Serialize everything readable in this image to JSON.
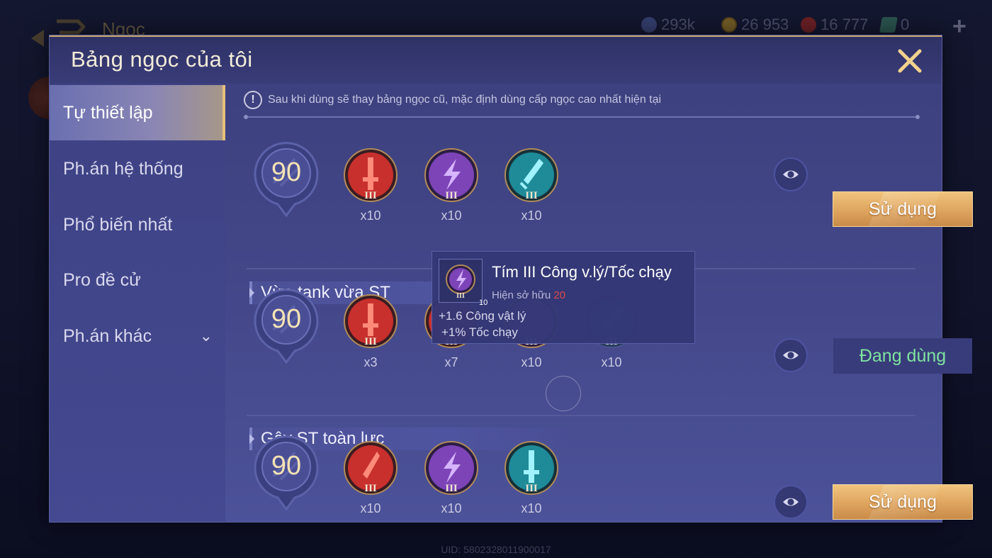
{
  "background": {
    "screen_title": "Ngọc",
    "currencies": [
      {
        "icon": "silver-coin-icon",
        "value": "293k"
      },
      {
        "icon": "gold-coin-icon",
        "value": "26 953"
      },
      {
        "icon": "ruby-icon",
        "value": "16 777"
      },
      {
        "icon": "voucher-icon",
        "value": "0"
      }
    ],
    "uid": "UID: 5802328011900017"
  },
  "modal": {
    "title": "Bảng ngọc của tôi",
    "notice": "Sau khi dùng sẽ thay bảng ngọc cũ, mặc định dùng cấp ngọc cao nhất hiện tại"
  },
  "sidebar": {
    "items": [
      {
        "label": "Tự thiết lập",
        "active": true
      },
      {
        "label": "Ph.án hệ thống",
        "active": false
      },
      {
        "label": "Phổ biến nhất",
        "active": false
      },
      {
        "label": "Pro đề cử",
        "active": false
      },
      {
        "label": "Ph.án khác",
        "active": false
      }
    ]
  },
  "sets": [
    {
      "name": "",
      "level": "90",
      "gems": [
        {
          "color": "red",
          "tier": "III",
          "count": "x10"
        },
        {
          "color": "purple",
          "tier": "III",
          "count": "x10"
        },
        {
          "color": "teal",
          "tier": "III",
          "count": "x10"
        }
      ],
      "action": "Sử dụng"
    },
    {
      "name": "Vừa tank vừa ST",
      "level": "90",
      "gems": [
        {
          "color": "red",
          "tier": "III",
          "count": "x3"
        },
        {
          "color": "red",
          "tier": "III",
          "count": "x7"
        },
        {
          "color": "purple",
          "tier": "III",
          "count": "x10"
        },
        {
          "color": "teal",
          "tier": "III",
          "count": "x10"
        }
      ],
      "action": "Đang dùng"
    },
    {
      "name": "Gây ST toàn lực",
      "level": "90",
      "gems": [
        {
          "color": "red",
          "tier": "III",
          "count": "x10"
        },
        {
          "color": "purple",
          "tier": "III",
          "count": "x10"
        },
        {
          "color": "teal",
          "tier": "III",
          "count": "x10"
        }
      ],
      "action": "Sử dụng"
    }
  ],
  "tooltip": {
    "name": "Tím III Công v.lý/Tốc chạy",
    "owned_label": "Hiện sở hữu",
    "owned_value": "20",
    "thumb_level": "10",
    "stats": [
      "+1.6 Công vật lý",
      "+1% Tốc chạy"
    ]
  },
  "colors": {
    "gem_red": "#c8302e",
    "gem_purple": "#7d44b8",
    "gem_teal": "#1f8a98",
    "gold_button": "#e0a761",
    "active_green": "#7fe3a0"
  }
}
